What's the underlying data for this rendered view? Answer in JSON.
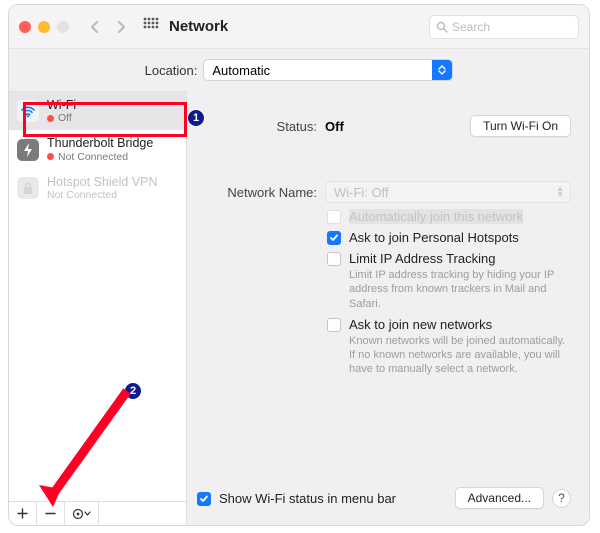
{
  "titlebar": {
    "title": "Network",
    "search_placeholder": "Search"
  },
  "location": {
    "label": "Location:",
    "value": "Automatic"
  },
  "sidebar": {
    "items": [
      {
        "name": "Wi-Fi",
        "status": "Off"
      },
      {
        "name": "Thunderbolt Bridge",
        "status": "Not Connected"
      },
      {
        "name": "Hotspot Shield VPN",
        "status": "Not Connected"
      }
    ]
  },
  "main": {
    "status_label": "Status:",
    "status_value": "Off",
    "turn_on_label": "Turn Wi-Fi On",
    "network_name_label": "Network Name:",
    "network_name_value": "Wi-Fi: Off",
    "options": {
      "auto_join": "Automatically join this network",
      "ask_personal": "Ask to join Personal Hotspots",
      "limit_ip": "Limit IP Address Tracking",
      "limit_ip_help": "Limit IP address tracking by hiding your IP address from known trackers in Mail and Safari.",
      "ask_new": "Ask to join new networks",
      "ask_new_help": "Known networks will be joined automatically. If no known networks are available, you will have to manually select a network."
    },
    "show_status_label": "Show Wi-Fi status in menu bar",
    "advanced_label": "Advanced..."
  },
  "annotations": {
    "one": "1",
    "two": "2"
  }
}
